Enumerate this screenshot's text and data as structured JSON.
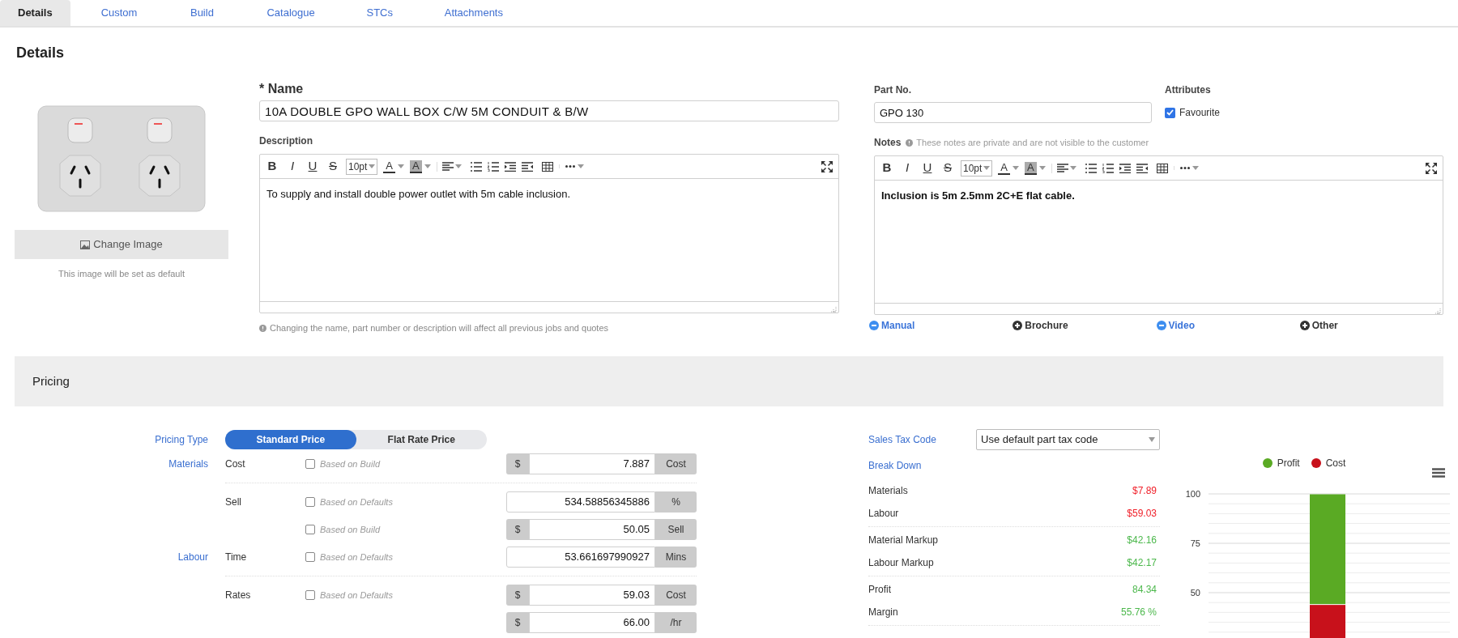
{
  "tabs": [
    {
      "label": "Details",
      "selected": true
    },
    {
      "label": "Custom",
      "selected": false
    },
    {
      "label": "Build",
      "selected": false
    },
    {
      "label": "Catalogue",
      "selected": false
    },
    {
      "label": "STCs",
      "selected": false
    },
    {
      "label": "Attachments",
      "selected": false
    }
  ],
  "details": {
    "heading": "Details",
    "image": {
      "button": "Change Image",
      "note": "This image will be set as default"
    },
    "name": {
      "label": "* Name",
      "value": "10A DOUBLE GPO WALL BOX C/W 5M CONDUIT & B/W"
    },
    "description": {
      "label": "Description",
      "toolbar": {
        "format": [
          "B",
          "I",
          "U",
          "S"
        ],
        "font_size": "10pt",
        "color_letters": [
          "A",
          "A"
        ]
      },
      "text": "To supply and install double power outlet with 5m cable inclusion."
    },
    "hint": "Changing the name, part number or description will affect all previous jobs and quotes",
    "part_no": {
      "label": "Part No.",
      "value": "GPO 130"
    },
    "attributes": {
      "label": "Attributes",
      "items": [
        {
          "label": "Favourite",
          "checked": true
        }
      ]
    },
    "notes": {
      "label": "Notes",
      "hint": "These notes are private and are not visible to the customer",
      "toolbar": {
        "format": [
          "B",
          "I",
          "U",
          "S"
        ],
        "font_size": "10pt",
        "color_letters": [
          "A",
          "A"
        ]
      },
      "text": "Inclusion is 5m 2.5mm 2C+E flat cable."
    },
    "attachments": [
      {
        "label": "Manual",
        "kind": "remove"
      },
      {
        "label": "Brochure",
        "kind": "add"
      },
      {
        "label": "Video",
        "kind": "remove"
      },
      {
        "label": "Other",
        "kind": "add"
      }
    ]
  },
  "pricing": {
    "heading": "Pricing",
    "pricing_type": {
      "label": "Pricing Type",
      "options": [
        {
          "label": "Standard Price",
          "selected": true
        },
        {
          "label": "Flat Rate Price",
          "selected": false
        }
      ]
    },
    "groups": [
      {
        "label": "Materials",
        "items": [
          {
            "label": "Cost",
            "lines": [
              {
                "checkbox_label": "Based on Build",
                "checked": false,
                "prefix": "$",
                "value": "7.887",
                "suffix": "Cost"
              }
            ]
          },
          {
            "label": "Sell",
            "lines": [
              {
                "checkbox_label": "Based on Defaults",
                "checked": false,
                "value": "534.58856345886",
                "suffix": "%"
              },
              {
                "checkbox_label": "Based on Build",
                "checked": false,
                "prefix": "$",
                "value": "50.05",
                "suffix": "Sell"
              }
            ]
          }
        ]
      },
      {
        "label": "Labour",
        "items": [
          {
            "label": "Time",
            "lines": [
              {
                "checkbox_label": "Based on Defaults",
                "checked": false,
                "value": "53.661697990927",
                "suffix": "Mins"
              }
            ]
          },
          {
            "label": "Rates",
            "lines": [
              {
                "checkbox_label": "Based on Defaults",
                "checked": false,
                "prefix": "$",
                "value": "59.03",
                "suffix": "Cost"
              },
              {
                "prefix": "$",
                "value": "66.00",
                "suffix": "/hr"
              }
            ]
          }
        ]
      }
    ],
    "tax": {
      "label": "Sales Tax Code",
      "value": "Use default part tax code"
    },
    "breakdown": {
      "label": "Break Down",
      "groups": [
        [
          {
            "label": "Materials",
            "value": "$7.89",
            "kind": "cost"
          },
          {
            "label": "Labour",
            "value": "$59.03",
            "kind": "cost"
          }
        ],
        [
          {
            "label": "Material Markup",
            "value": "$42.16",
            "kind": "gain"
          },
          {
            "label": "Labour Markup",
            "value": "$42.17",
            "kind": "gain"
          }
        ],
        [
          {
            "label": "Profit",
            "value": "84.34",
            "kind": "gain"
          },
          {
            "label": "Margin",
            "value": "55.76 %",
            "kind": "gain"
          }
        ]
      ]
    },
    "chart_data": {
      "type": "bar",
      "stacked": true,
      "legend": "top",
      "series": [
        {
          "name": "Profit",
          "color": "#5aaa24",
          "values": [
            56
          ]
        },
        {
          "name": "Cost",
          "color": "#c8111b",
          "values": [
            44
          ]
        }
      ],
      "ylim": [
        0,
        100
      ],
      "yticks": [
        50,
        75,
        100
      ]
    }
  }
}
